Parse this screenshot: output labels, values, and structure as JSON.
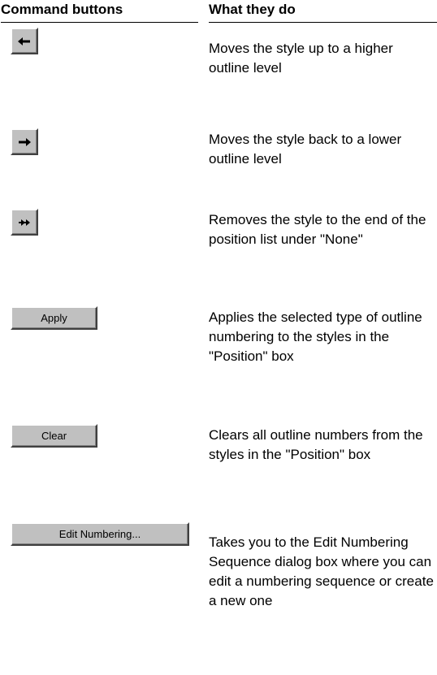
{
  "header": {
    "col1": "Command buttons",
    "col2": "What they do"
  },
  "rows": [
    {
      "button_icon": "arrow-left-icon",
      "description": "Moves the style up to a higher outline level"
    },
    {
      "button_icon": "arrow-right-icon",
      "description": "Moves the style back to a lower outline level"
    },
    {
      "button_icon": "double-arrow-right-icon",
      "description": "Removes the style to the end of the position list under \"None\""
    },
    {
      "button_label": "Apply",
      "description": "Applies the selected type of outline numbering to the styles in the \"Position\" box"
    },
    {
      "button_label": "Clear",
      "description": "Clears all outline numbers from the styles in the \"Position\" box"
    },
    {
      "button_label": "Edit Numbering...",
      "description": "Takes you to the Edit Numbering Sequence dialog box where you can edit a numbering sequence or create a new one"
    }
  ]
}
